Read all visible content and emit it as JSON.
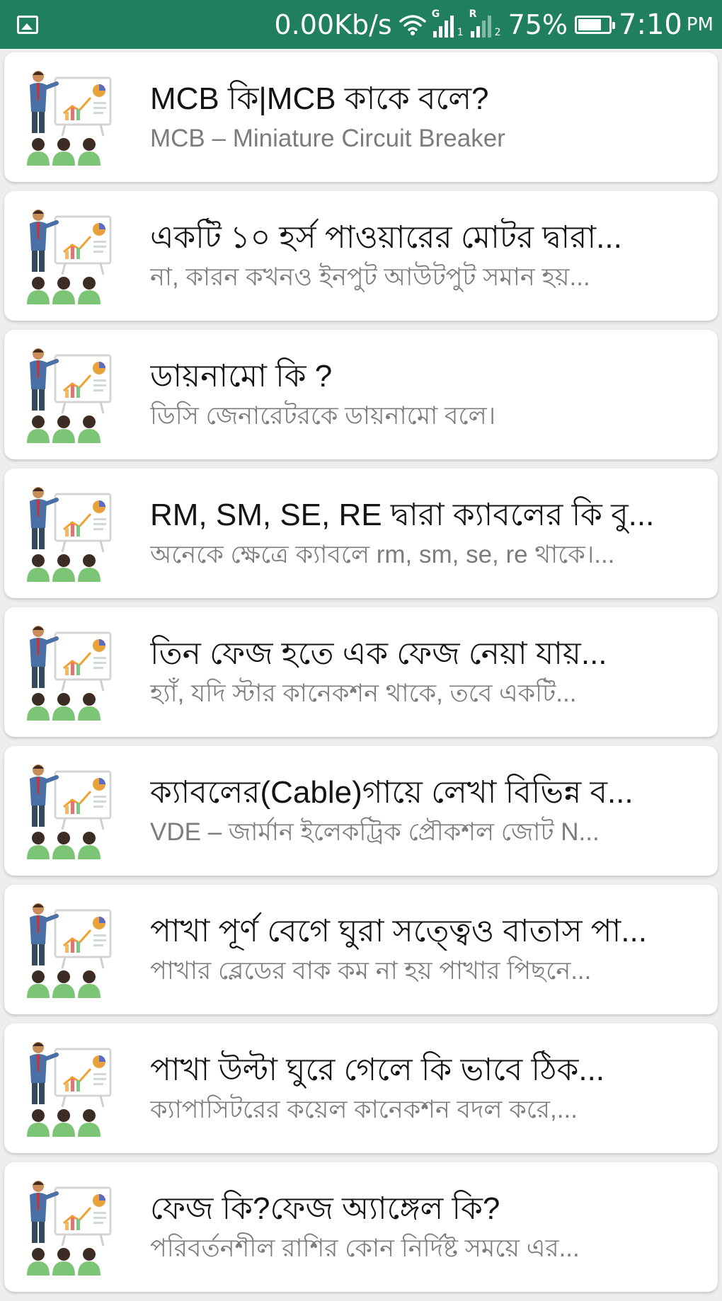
{
  "status_bar": {
    "net_speed": "0.00Kb/s",
    "sim1_tag": "G",
    "sim1_index": "1",
    "sim2_tag": "R",
    "sim2_index": "2",
    "battery_percent": "75%",
    "battery_level": 0.75,
    "time": "7:10",
    "ampm": "PM",
    "icons": [
      "gallery-icon",
      "wifi-icon",
      "signal-icon",
      "signal-icon",
      "battery-icon"
    ]
  },
  "colors": {
    "status_bar": "#1f7f5e",
    "background": "#eeeeee",
    "title": "#141414",
    "subtitle": "#7c7c7c"
  },
  "items": [
    {
      "title": "MCB কি|MCB কাকে বলে?",
      "subtitle": "MCB – Miniature Circuit Breaker",
      "icon": "presentation-icon"
    },
    {
      "title": "একটি ১০ হর্স পাওয়ারের মোটর দ্বারা...",
      "subtitle": "না, কারন কখনও ইনপুট আউটপুট সমান হয়...",
      "icon": "presentation-icon"
    },
    {
      "title": "ডায়নামো কি ?",
      "subtitle": "ডিসি জেনারেটরকে ডায়নামো বলে।",
      "icon": "presentation-icon"
    },
    {
      "title": "RM, SM, SE, RE দ্বারা ক্যাবলের কি বু...",
      "subtitle": "অনেকে ক্ষেত্রে ক্যাবলে rm, sm, se, re থাকে।...",
      "icon": "presentation-icon"
    },
    {
      "title": "তিন ফেজ হতে এক ফেজ নেয়া যায়...",
      "subtitle": "হ্যাঁ, যদি স্টার কানেকশন থাকে, তবে একটি...",
      "icon": "presentation-icon"
    },
    {
      "title": "ক্যাবলের(Cable)গায়ে লেখা বিভিন্ন ব...",
      "subtitle": "VDE – জার্মান ইলেকট্রিক প্রৌকশল জোট N...",
      "icon": "presentation-icon"
    },
    {
      "title": "পাখা পূর্ণ বেগে ঘুরা সত্ত্বেও বাতাস পা...",
      "subtitle": "পাখার ব্লেডের বাক কম না হয় পাখার পিছনে...",
      "icon": "presentation-icon"
    },
    {
      "title": "পাখা উল্টা ঘুরে গেলে কি ভাবে ঠিক...",
      "subtitle": " ক্যাপাসিটরের কয়েল কানেকশন বদল করে,...",
      "icon": "presentation-icon"
    },
    {
      "title": "ফেজ কি?ফেজ অ্যাঙ্গেল কি?",
      "subtitle": "পরিবর্তনশীল রাশির কোন নির্দিষ্ট সময়ে এর...",
      "icon": "presentation-icon"
    }
  ]
}
